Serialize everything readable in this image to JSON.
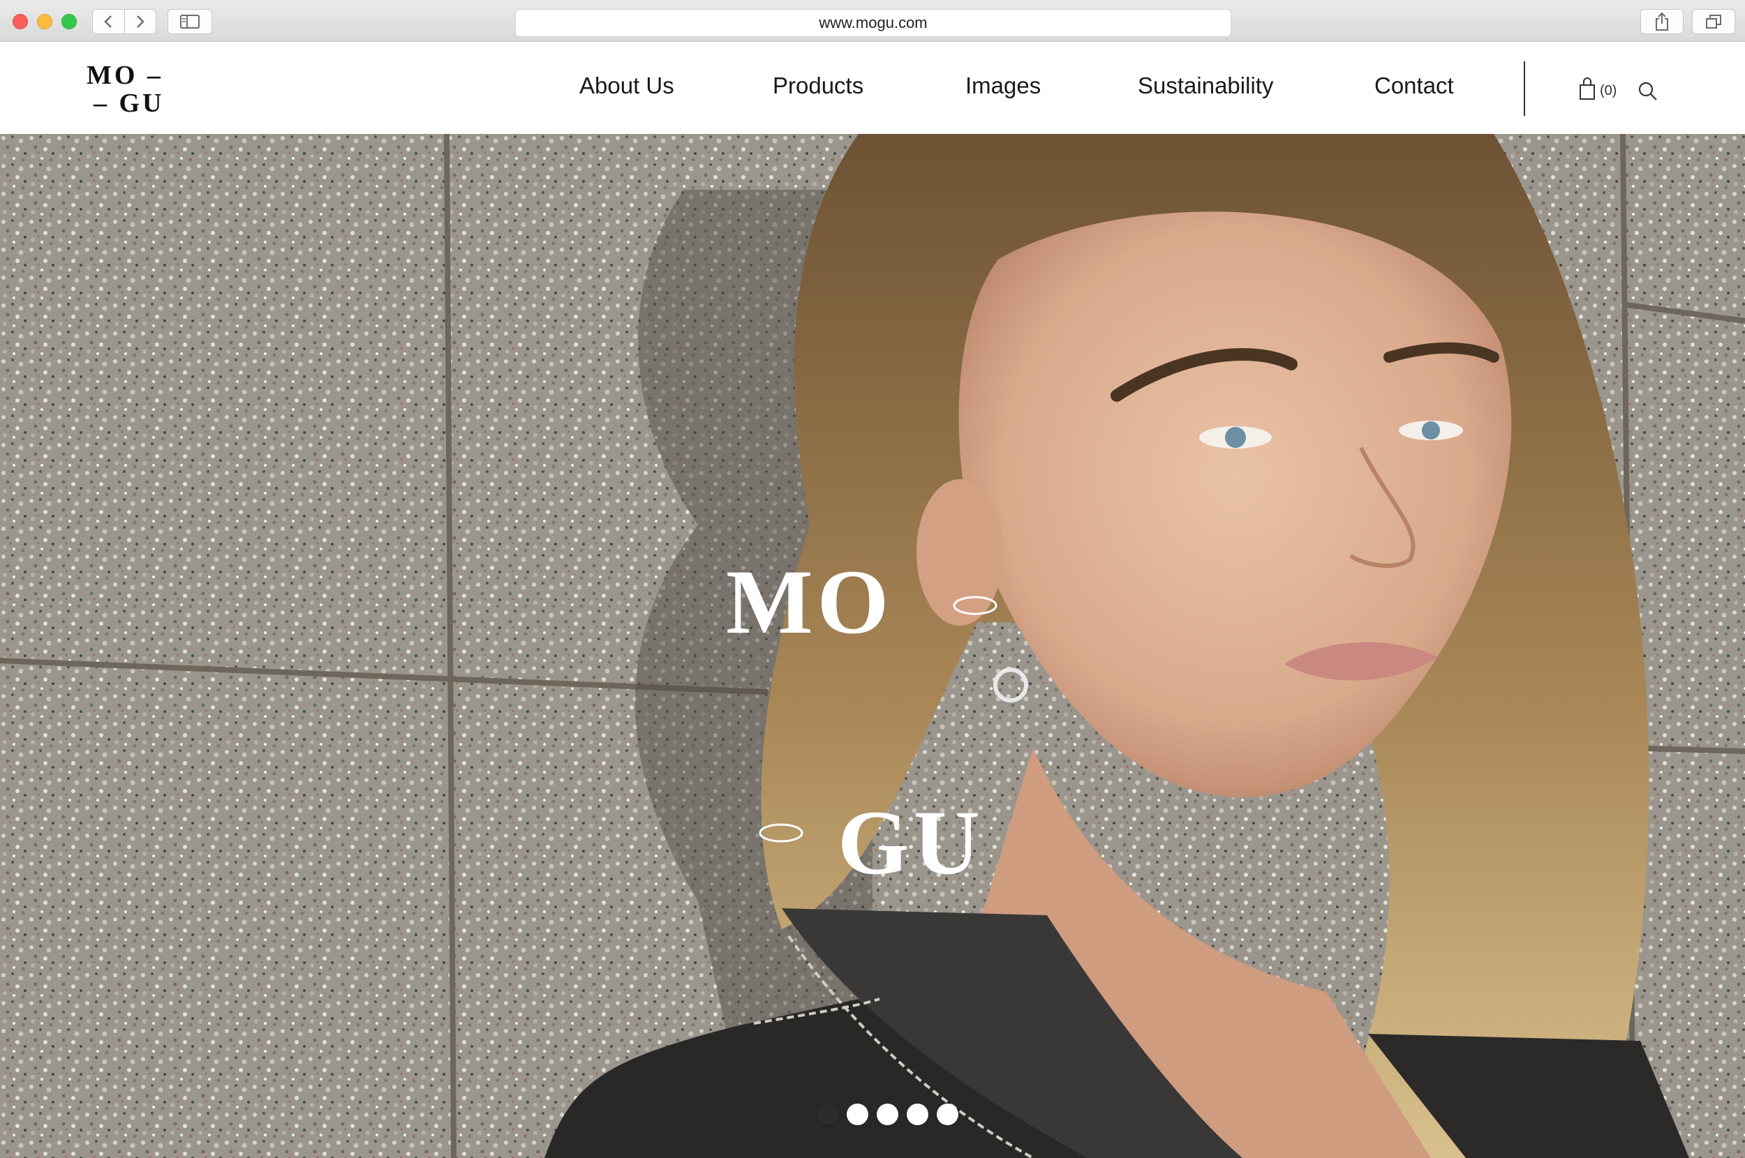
{
  "browser": {
    "url": "www.mogu.com",
    "icons": [
      "back-icon",
      "forward-icon",
      "sidebar-icon",
      "share-icon",
      "tabs-icon"
    ]
  },
  "site": {
    "logo_line1": "MO –",
    "logo_line2": "– GU",
    "nav": [
      "About Us",
      "Products",
      "Images",
      "Sustainability",
      "Contact"
    ],
    "cart_count": "(0)",
    "icons": [
      "bag-icon",
      "search-icon"
    ]
  },
  "hero": {
    "logo_line1": "MO",
    "logo_line2": "GU",
    "slide_count": 5,
    "active_slide": 1
  },
  "colors": {
    "text": "#1a1a1a",
    "hero_text": "#ffffff",
    "active_dot": "#2c2c2c"
  }
}
